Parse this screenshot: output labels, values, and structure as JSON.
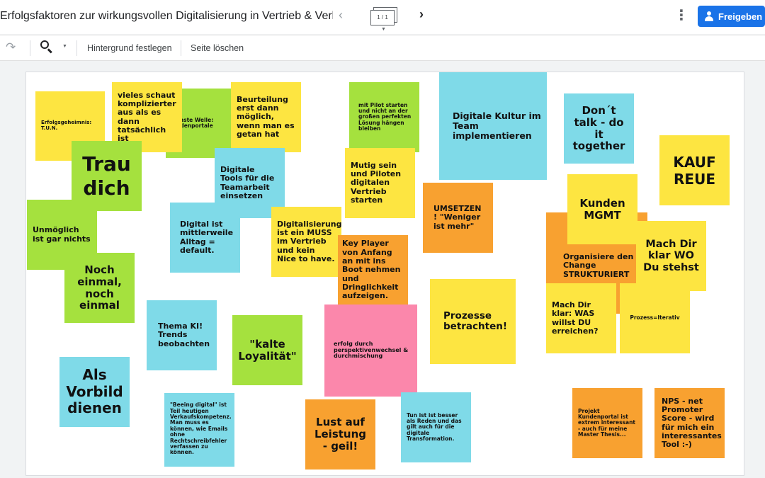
{
  "header": {
    "title": "Erfolgsfaktoren zur wirkungsvollen Digitalisierung in Vertrieb & Verka…",
    "page_indicator": "1 / 1",
    "share_label": "Freigeben"
  },
  "toolbar": {
    "set_background": "Hintergrund festlegen",
    "delete_page": "Seite löschen"
  },
  "icons": {
    "redo": "redo-icon",
    "zoom": "zoom-icon",
    "prev": "chevron-left-icon",
    "next": "chevron-right-icon",
    "more": "more-vert-icon",
    "share": "person-add-icon"
  },
  "colors": {
    "yellow": "#fde541",
    "green": "#a5e13e",
    "blue": "#7fdae8",
    "orange": "#f8a130",
    "pink": "#fb87ab",
    "accent": "#1a73e8"
  },
  "notes": [
    {
      "text": "Erfolgsgeheimnis: T.U.N.",
      "color": "yellow"
    },
    {
      "text": "Nächste Welle: Kundenportale",
      "color": "green"
    },
    {
      "text": "vieles schaut komplizierter aus als es dann tatsächlich ist",
      "color": "yellow"
    },
    {
      "text": "Beurteilung erst dann möglich, wenn man es getan hat",
      "color": "yellow"
    },
    {
      "text": "mit Pilot starten und nicht an der großen perfekten Lösung hängen bleiben",
      "color": "green"
    },
    {
      "text": "Digitale Kultur im Team implementieren",
      "color": "blue"
    },
    {
      "text": "Don´t talk - do it together",
      "color": "blue"
    },
    {
      "text": "Trau dich",
      "color": "green"
    },
    {
      "text": "Digitale Tools für die Teamarbeit einsetzen",
      "color": "blue"
    },
    {
      "text": "Mutig sein und Piloten digitalen Vertrieb starten",
      "color": "yellow"
    },
    {
      "text": "KAUF REUE",
      "color": "yellow"
    },
    {
      "text": "Unmöglich ist gar nichts",
      "color": "green"
    },
    {
      "text": "Digital ist mittlerweile Alltag = default.",
      "color": "blue"
    },
    {
      "text": "Digitalisierung ist ein MUSS im Vertrieb und kein Nice to have.",
      "color": "yellow"
    },
    {
      "text": "UMSETZEN ! \"Weniger ist mehr\"",
      "color": "orange"
    },
    {
      "text": "Organisiere den Change STRUKTURIERT",
      "color": "orange"
    },
    {
      "text": "Kunden MGMT",
      "color": "yellow"
    },
    {
      "text": "Mach Dir klar WO Du stehst",
      "color": "yellow"
    },
    {
      "text": "Noch einmal, noch einmal",
      "color": "green"
    },
    {
      "text": "Key Player von Anfang an mit ins Boot nehmen und Dringlichkeit aufzeigen.",
      "color": "orange"
    },
    {
      "text": "Prozesse betrachten!",
      "color": "yellow"
    },
    {
      "text": "Mach Dir klar: WAS willst DU erreichen?",
      "color": "yellow"
    },
    {
      "text": "Prozess=Iterativ",
      "color": "yellow"
    },
    {
      "text": "Thema KI! Trends beobachten",
      "color": "blue"
    },
    {
      "text": "\"kalte Loyalität\"",
      "color": "green"
    },
    {
      "text": "erfolg durch perspektivenwechsel & durchmischung",
      "color": "pink"
    },
    {
      "text": "Als Vorbild dienen",
      "color": "blue"
    },
    {
      "text": "\"Beeing digital\" ist Teil heutigen Verkaufskompetenz. Man muss es können, wie Emails ohne Rechtschreibfehler verfassen zu können.",
      "color": "blue"
    },
    {
      "text": "Lust auf Leistung - geil!",
      "color": "orange"
    },
    {
      "text": "Tun ist ist besser als Reden und das gilt auch für die digitale Transformation.",
      "color": "blue"
    },
    {
      "text": "Projekt Kundenportal ist extrem interessant - auch für meine Master Thesis...",
      "color": "orange"
    },
    {
      "text": "NPS - net Promoter Score - wird für mich ein interessantes Tool :-)",
      "color": "orange"
    }
  ]
}
